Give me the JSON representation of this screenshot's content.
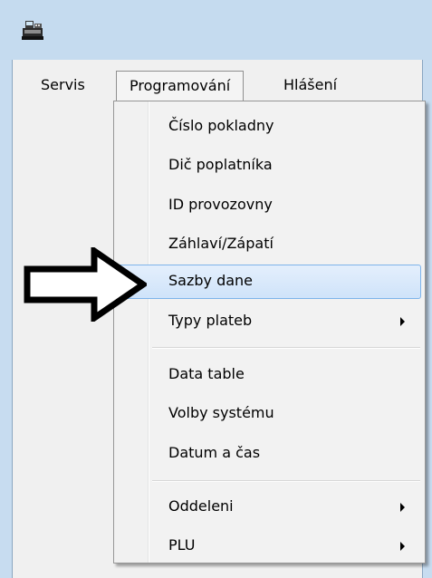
{
  "window": {
    "app_icon": "cash-register-icon"
  },
  "menubar": {
    "items": [
      "Servis",
      "Programování",
      "Hlášení"
    ],
    "active": "Programování"
  },
  "dropdown": {
    "groups": [
      [
        {
          "label": "Číslo pokladny"
        },
        {
          "label": "Dič poplatníka"
        },
        {
          "label": "ID provozovny"
        },
        {
          "label": "Záhlaví/Zápatí"
        },
        {
          "label": "Sazby dane",
          "highlighted": true
        },
        {
          "label": "Typy plateb",
          "submenu": true
        }
      ],
      [
        {
          "label": "Data table"
        },
        {
          "label": "Volby systému"
        },
        {
          "label": "Datum a čas"
        }
      ],
      [
        {
          "label": "Oddeleni",
          "submenu": true
        },
        {
          "label": "PLU",
          "submenu": true
        }
      ]
    ]
  },
  "annotation": {
    "icon": "right-arrow-icon",
    "points_to": "Sazby dane"
  },
  "colors": {
    "titlebar": "#c5dbef",
    "highlight_border": "#7eb4ea",
    "highlight_fill": "#d8e8fb"
  }
}
